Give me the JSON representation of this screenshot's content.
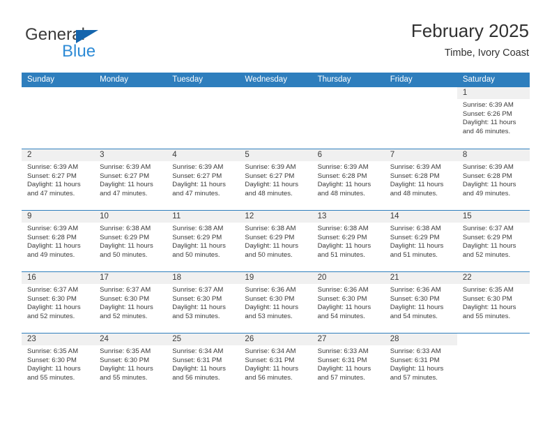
{
  "brand": {
    "name_part1": "General",
    "name_part2": "Blue",
    "accent_color": "#2e8bd6",
    "triangle_color": "#1565ad"
  },
  "header": {
    "title": "February 2025",
    "subtitle": "Timbe, Ivory Coast"
  },
  "theme": {
    "header_blue": "#2e7ebd",
    "daynum_band": "#f0f0f0",
    "text": "#3a3a3a"
  },
  "weekdays": [
    "Sunday",
    "Monday",
    "Tuesday",
    "Wednesday",
    "Thursday",
    "Friday",
    "Saturday"
  ],
  "weeks": [
    [
      {
        "day": "",
        "blank": true
      },
      {
        "day": "",
        "blank": true
      },
      {
        "day": "",
        "blank": true
      },
      {
        "day": "",
        "blank": true
      },
      {
        "day": "",
        "blank": true
      },
      {
        "day": "",
        "blank": true
      },
      {
        "day": "1",
        "sunrise": "Sunrise: 6:39 AM",
        "sunset": "Sunset: 6:26 PM",
        "daylight": "Daylight: 11 hours and 46 minutes."
      }
    ],
    [
      {
        "day": "2",
        "sunrise": "Sunrise: 6:39 AM",
        "sunset": "Sunset: 6:27 PM",
        "daylight": "Daylight: 11 hours and 47 minutes."
      },
      {
        "day": "3",
        "sunrise": "Sunrise: 6:39 AM",
        "sunset": "Sunset: 6:27 PM",
        "daylight": "Daylight: 11 hours and 47 minutes."
      },
      {
        "day": "4",
        "sunrise": "Sunrise: 6:39 AM",
        "sunset": "Sunset: 6:27 PM",
        "daylight": "Daylight: 11 hours and 47 minutes."
      },
      {
        "day": "5",
        "sunrise": "Sunrise: 6:39 AM",
        "sunset": "Sunset: 6:27 PM",
        "daylight": "Daylight: 11 hours and 48 minutes."
      },
      {
        "day": "6",
        "sunrise": "Sunrise: 6:39 AM",
        "sunset": "Sunset: 6:28 PM",
        "daylight": "Daylight: 11 hours and 48 minutes."
      },
      {
        "day": "7",
        "sunrise": "Sunrise: 6:39 AM",
        "sunset": "Sunset: 6:28 PM",
        "daylight": "Daylight: 11 hours and 48 minutes."
      },
      {
        "day": "8",
        "sunrise": "Sunrise: 6:39 AM",
        "sunset": "Sunset: 6:28 PM",
        "daylight": "Daylight: 11 hours and 49 minutes."
      }
    ],
    [
      {
        "day": "9",
        "sunrise": "Sunrise: 6:39 AM",
        "sunset": "Sunset: 6:28 PM",
        "daylight": "Daylight: 11 hours and 49 minutes."
      },
      {
        "day": "10",
        "sunrise": "Sunrise: 6:38 AM",
        "sunset": "Sunset: 6:29 PM",
        "daylight": "Daylight: 11 hours and 50 minutes."
      },
      {
        "day": "11",
        "sunrise": "Sunrise: 6:38 AM",
        "sunset": "Sunset: 6:29 PM",
        "daylight": "Daylight: 11 hours and 50 minutes."
      },
      {
        "day": "12",
        "sunrise": "Sunrise: 6:38 AM",
        "sunset": "Sunset: 6:29 PM",
        "daylight": "Daylight: 11 hours and 50 minutes."
      },
      {
        "day": "13",
        "sunrise": "Sunrise: 6:38 AM",
        "sunset": "Sunset: 6:29 PM",
        "daylight": "Daylight: 11 hours and 51 minutes."
      },
      {
        "day": "14",
        "sunrise": "Sunrise: 6:38 AM",
        "sunset": "Sunset: 6:29 PM",
        "daylight": "Daylight: 11 hours and 51 minutes."
      },
      {
        "day": "15",
        "sunrise": "Sunrise: 6:37 AM",
        "sunset": "Sunset: 6:29 PM",
        "daylight": "Daylight: 11 hours and 52 minutes."
      }
    ],
    [
      {
        "day": "16",
        "sunrise": "Sunrise: 6:37 AM",
        "sunset": "Sunset: 6:30 PM",
        "daylight": "Daylight: 11 hours and 52 minutes."
      },
      {
        "day": "17",
        "sunrise": "Sunrise: 6:37 AM",
        "sunset": "Sunset: 6:30 PM",
        "daylight": "Daylight: 11 hours and 52 minutes."
      },
      {
        "day": "18",
        "sunrise": "Sunrise: 6:37 AM",
        "sunset": "Sunset: 6:30 PM",
        "daylight": "Daylight: 11 hours and 53 minutes."
      },
      {
        "day": "19",
        "sunrise": "Sunrise: 6:36 AM",
        "sunset": "Sunset: 6:30 PM",
        "daylight": "Daylight: 11 hours and 53 minutes."
      },
      {
        "day": "20",
        "sunrise": "Sunrise: 6:36 AM",
        "sunset": "Sunset: 6:30 PM",
        "daylight": "Daylight: 11 hours and 54 minutes."
      },
      {
        "day": "21",
        "sunrise": "Sunrise: 6:36 AM",
        "sunset": "Sunset: 6:30 PM",
        "daylight": "Daylight: 11 hours and 54 minutes."
      },
      {
        "day": "22",
        "sunrise": "Sunrise: 6:35 AM",
        "sunset": "Sunset: 6:30 PM",
        "daylight": "Daylight: 11 hours and 55 minutes."
      }
    ],
    [
      {
        "day": "23",
        "sunrise": "Sunrise: 6:35 AM",
        "sunset": "Sunset: 6:30 PM",
        "daylight": "Daylight: 11 hours and 55 minutes."
      },
      {
        "day": "24",
        "sunrise": "Sunrise: 6:35 AM",
        "sunset": "Sunset: 6:30 PM",
        "daylight": "Daylight: 11 hours and 55 minutes."
      },
      {
        "day": "25",
        "sunrise": "Sunrise: 6:34 AM",
        "sunset": "Sunset: 6:31 PM",
        "daylight": "Daylight: 11 hours and 56 minutes."
      },
      {
        "day": "26",
        "sunrise": "Sunrise: 6:34 AM",
        "sunset": "Sunset: 6:31 PM",
        "daylight": "Daylight: 11 hours and 56 minutes."
      },
      {
        "day": "27",
        "sunrise": "Sunrise: 6:33 AM",
        "sunset": "Sunset: 6:31 PM",
        "daylight": "Daylight: 11 hours and 57 minutes."
      },
      {
        "day": "28",
        "sunrise": "Sunrise: 6:33 AM",
        "sunset": "Sunset: 6:31 PM",
        "daylight": "Daylight: 11 hours and 57 minutes."
      },
      {
        "day": "",
        "blank": true
      }
    ]
  ]
}
